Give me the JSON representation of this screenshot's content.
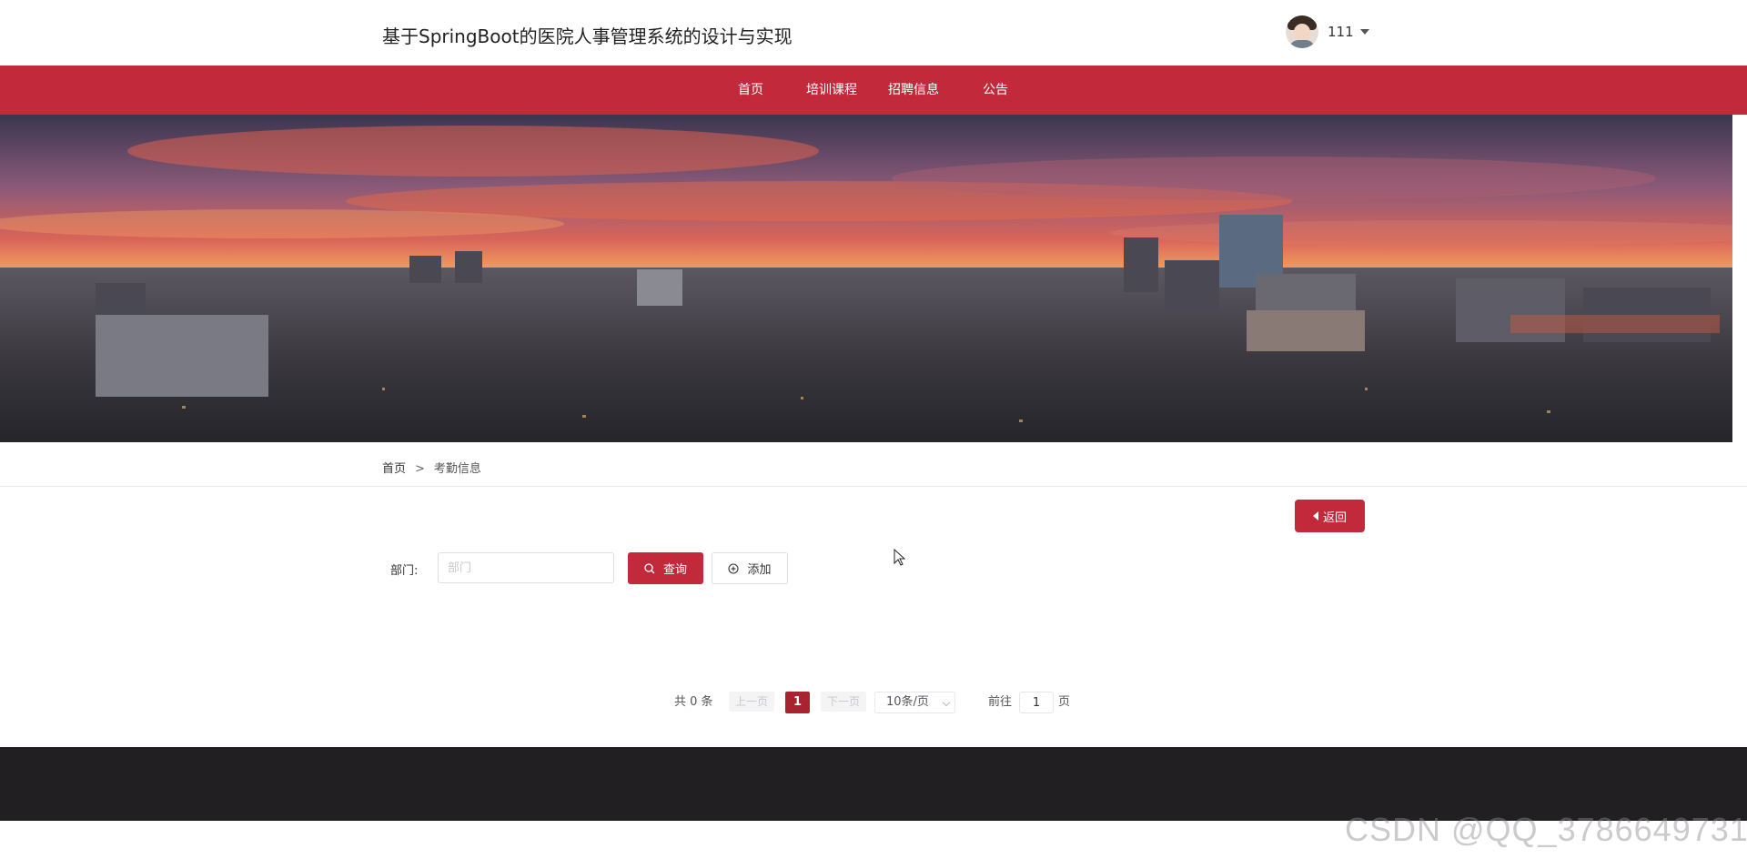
{
  "header": {
    "title": "基于SpringBoot的医院人事管理系统的设计与实现",
    "user_name": "111"
  },
  "nav": {
    "items": [
      "首页",
      "培训课程",
      "招聘信息",
      "公告"
    ]
  },
  "breadcrumb": {
    "home": "首页",
    "separator": ">",
    "current": "考勤信息"
  },
  "actions": {
    "back_label": "返回"
  },
  "filter": {
    "label": "部门:",
    "placeholder": "部门",
    "value": "",
    "query_label": "查询",
    "add_label": "添加"
  },
  "pagination": {
    "total_text": "共 0 条",
    "prev_label": "上一页",
    "current_page": "1",
    "next_label": "下一页",
    "page_size": "10条/页",
    "goto_label": "前往",
    "goto_value": "1",
    "page_suffix": "页"
  },
  "watermark": "CSDN @QQ_3786649731",
  "colors": {
    "brand": "#c2293b",
    "active_page": "#a8232f",
    "footer": "#211f22"
  },
  "icons": {
    "back": "caret-left-icon",
    "query": "search-icon",
    "add": "plus-circle-icon",
    "user_menu": "caret-down-icon"
  }
}
